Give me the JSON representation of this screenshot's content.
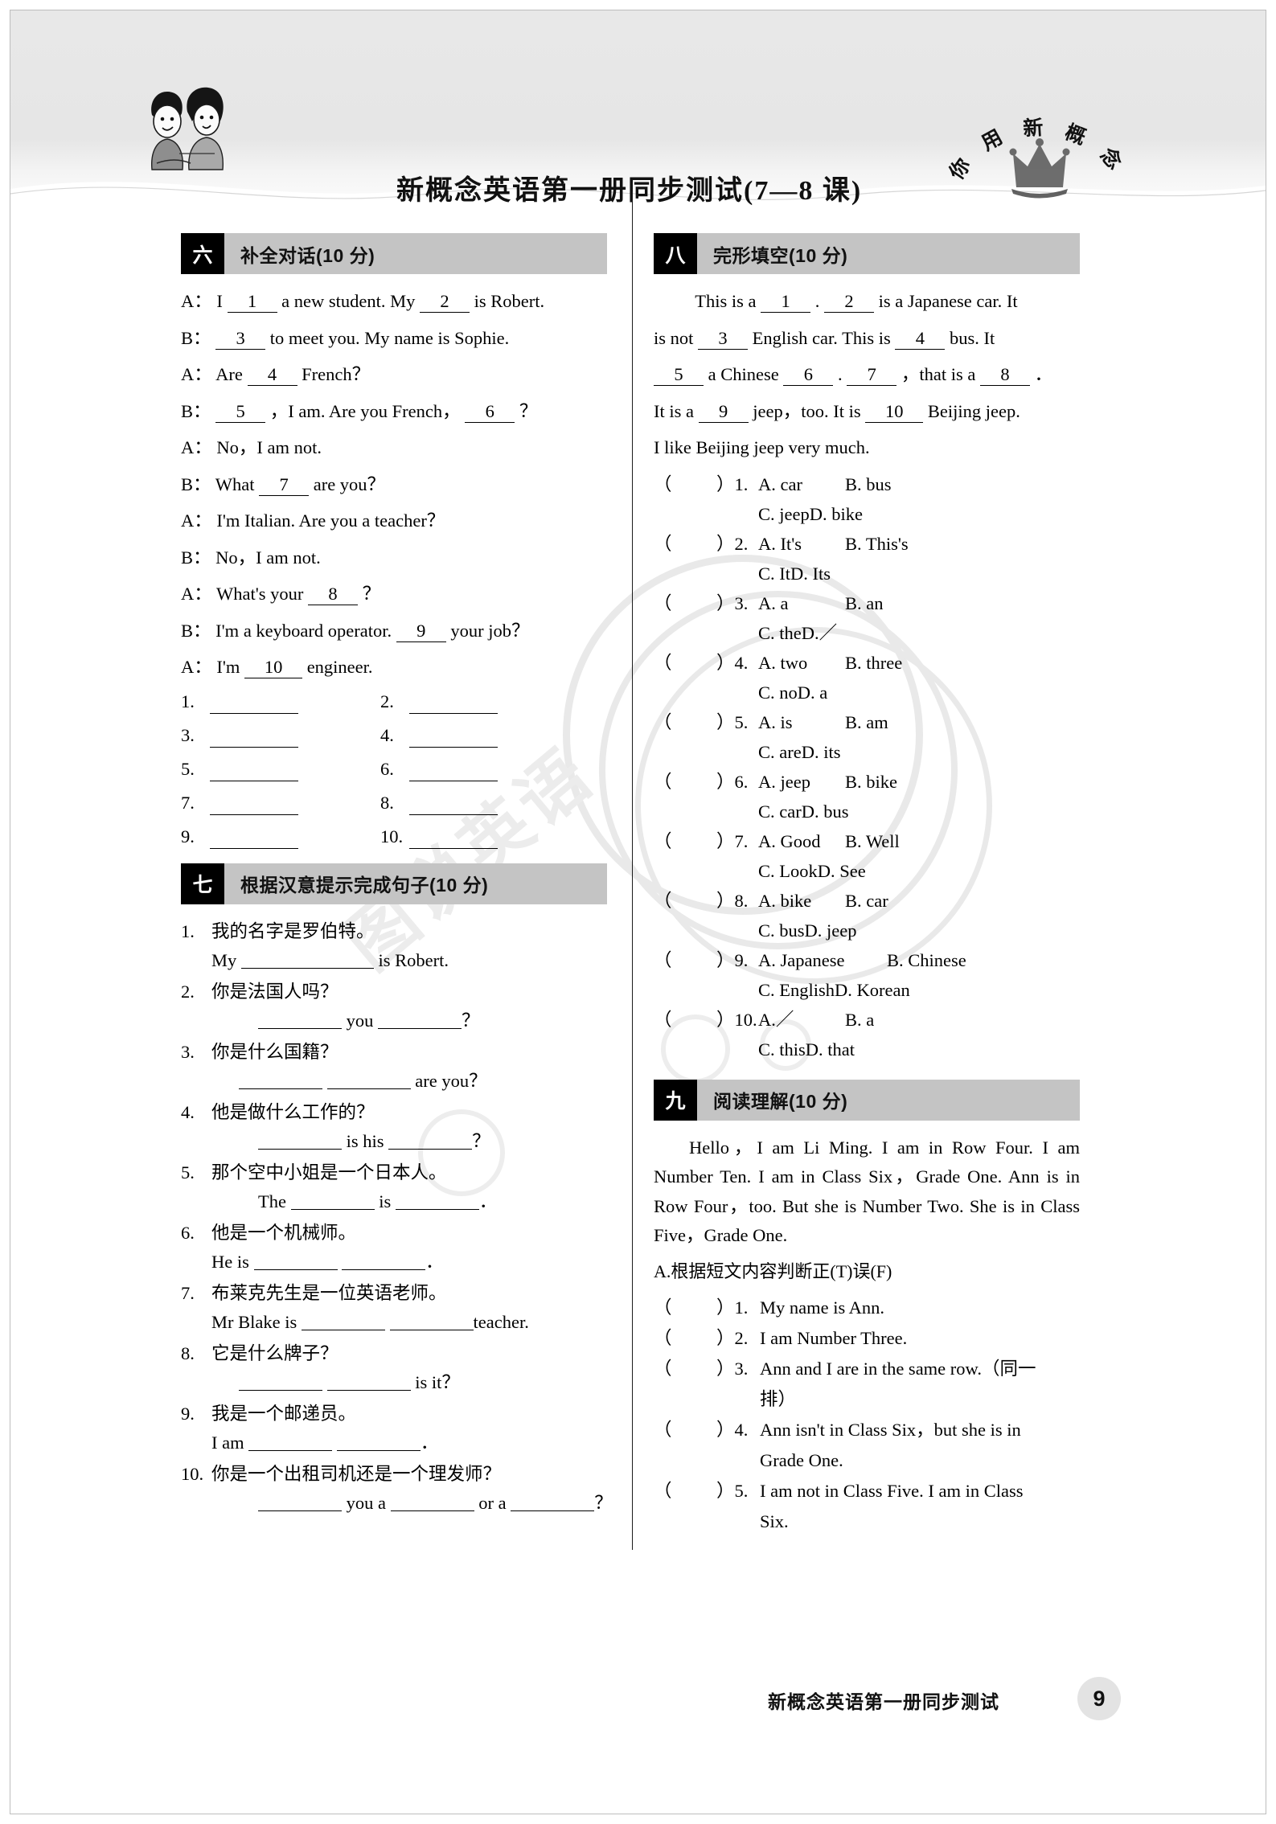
{
  "header": {
    "title": "新概念英语第一册同步测试(7—8 课)",
    "logo_chars": [
      "你",
      "用",
      "新",
      "概",
      "念"
    ],
    "mascot_alt": "two-students-illustration"
  },
  "watermark": {
    "text": "图说英语"
  },
  "sections": {
    "six": {
      "number": "六",
      "title": "补全对话(10 分)",
      "dialogue": [
        {
          "speaker": "A：",
          "parts": [
            {
              "t": "text",
              "v": "I"
            },
            {
              "t": "blank",
              "v": "1"
            },
            {
              "t": "text",
              "v": "a new student.  My"
            },
            {
              "t": "blank",
              "v": "2"
            },
            {
              "t": "text",
              "v": "is Robert."
            }
          ]
        },
        {
          "speaker": "B：",
          "parts": [
            {
              "t": "blank",
              "v": "3"
            },
            {
              "t": "text",
              "v": "to meet you.  My name is Sophie."
            }
          ]
        },
        {
          "speaker": "A：",
          "parts": [
            {
              "t": "text",
              "v": "Are"
            },
            {
              "t": "blank",
              "v": "4"
            },
            {
              "t": "text",
              "v": "French？"
            }
          ]
        },
        {
          "speaker": "B：",
          "parts": [
            {
              "t": "blank",
              "v": "5"
            },
            {
              "t": "text",
              "v": "，I am.  Are you French，"
            },
            {
              "t": "blank",
              "v": "6"
            },
            {
              "t": "text",
              "v": "？"
            }
          ]
        },
        {
          "speaker": "A：",
          "parts": [
            {
              "t": "text",
              "v": "No，I am not."
            }
          ]
        },
        {
          "speaker": "B：",
          "parts": [
            {
              "t": "text",
              "v": "What"
            },
            {
              "t": "blank",
              "v": "7"
            },
            {
              "t": "text",
              "v": "are you？"
            }
          ]
        },
        {
          "speaker": "A：",
          "parts": [
            {
              "t": "text",
              "v": "I'm Italian.  Are you a teacher？"
            }
          ]
        },
        {
          "speaker": "B：",
          "parts": [
            {
              "t": "text",
              "v": "No，I am not."
            }
          ]
        },
        {
          "speaker": "A：",
          "parts": [
            {
              "t": "text",
              "v": "What's your"
            },
            {
              "t": "blank",
              "v": "8"
            },
            {
              "t": "text",
              "v": "？"
            }
          ]
        },
        {
          "speaker": "B：",
          "parts": [
            {
              "t": "text",
              "v": "I'm a keyboard operator."
            },
            {
              "t": "blank",
              "v": "9"
            },
            {
              "t": "text",
              "v": "your job？"
            }
          ]
        },
        {
          "speaker": "A：",
          "parts": [
            {
              "t": "text",
              "v": "I'm"
            },
            {
              "t": "blank",
              "v": "10"
            },
            {
              "t": "text",
              "v": "engineer."
            }
          ]
        }
      ],
      "answer_numbers": [
        "1.",
        "2.",
        "3.",
        "4.",
        "5.",
        "6.",
        "7.",
        "8.",
        "9.",
        "10."
      ]
    },
    "seven": {
      "number": "七",
      "title": "根据汉意提示完成句子(10 分)",
      "items": [
        {
          "n": "1.",
          "cn": "我的名字是罗伯特。",
          "en_pre": "My",
          "blanks": 1,
          "en_post": "is Robert.",
          "style": "a"
        },
        {
          "n": "2.",
          "cn": "你是法国人吗？",
          "en_pre": "",
          "blanks": 2,
          "en_mid": "you",
          "en_post": "？",
          "style": "b"
        },
        {
          "n": "3.",
          "cn": "你是什么国籍？",
          "en_pre": "",
          "blanks": 2,
          "en_post": "are you？",
          "style": "c"
        },
        {
          "n": "4.",
          "cn": "他是做什么工作的？",
          "en_pre": "",
          "blanks": 2,
          "en_mid": "is his",
          "en_post": "？",
          "style": "b"
        },
        {
          "n": "5.",
          "cn": "那个空中小姐是一个日本人。",
          "en_pre": "The",
          "blanks": 2,
          "en_mid": "is",
          "en_post": "．",
          "style": "b"
        },
        {
          "n": "6.",
          "cn": "他是一个机械师。",
          "en_pre": "He is",
          "blanks": 2,
          "en_post": "．",
          "style": "d"
        },
        {
          "n": "7.",
          "cn": "布莱克先生是一位英语老师。",
          "en_pre": "Mr Blake is",
          "blanks": 2,
          "en_post": "teacher.",
          "style": "d"
        },
        {
          "n": "8.",
          "cn": "它是什么牌子？",
          "en_pre": "",
          "blanks": 2,
          "en_post": "is it？",
          "style": "c"
        },
        {
          "n": "9.",
          "cn": "我是一个邮递员。",
          "en_pre": "I am",
          "blanks": 2,
          "en_post": "．",
          "style": "d"
        },
        {
          "n": "10.",
          "cn": "你是一个出租司机还是一个理发师？",
          "en_pre": "",
          "blanks": 3,
          "en_mid": "you a",
          "en_mid2": "or a",
          "en_post": "？",
          "style": "e"
        }
      ]
    },
    "eight": {
      "number": "八",
      "title": "完形填空(10 分)",
      "passage_lines": [
        [
          {
            "t": "indent"
          },
          {
            "t": "text",
            "v": "This is a"
          },
          {
            "t": "blank",
            "v": "1"
          },
          {
            "t": "text",
            "v": ".  "
          },
          {
            "t": "blank",
            "v": "2"
          },
          {
            "t": "text",
            "v": "is a Japanese car.  It"
          }
        ],
        [
          {
            "t": "text",
            "v": "is not"
          },
          {
            "t": "blank",
            "v": "3"
          },
          {
            "t": "text",
            "v": "English car.  This is"
          },
          {
            "t": "blank",
            "v": "4"
          },
          {
            "t": "text",
            "v": "bus.  It"
          }
        ],
        [
          {
            "t": "blank",
            "v": "5"
          },
          {
            "t": "text",
            "v": "a Chinese"
          },
          {
            "t": "blank",
            "v": "6"
          },
          {
            "t": "text",
            "v": ".  "
          },
          {
            "t": "blank",
            "v": "7"
          },
          {
            "t": "text",
            "v": "，that is a"
          },
          {
            "t": "blank",
            "v": "8"
          },
          {
            "t": "text",
            "v": "．"
          }
        ],
        [
          {
            "t": "text",
            "v": "It is a"
          },
          {
            "t": "blank",
            "v": "9"
          },
          {
            "t": "text",
            "v": "jeep，too.  It is"
          },
          {
            "t": "blank",
            "v": "10"
          },
          {
            "t": "text",
            "v": "Beijing jeep."
          }
        ],
        [
          {
            "t": "text",
            "v": "I like Beijing jeep very much."
          }
        ]
      ],
      "questions": [
        {
          "n": "1.",
          "a": "A. car",
          "b": "B. bus",
          "c": "C. jeep",
          "d": "D. bike",
          "wide": false
        },
        {
          "n": "2.",
          "a": "A.  It's",
          "b": "B. This's",
          "c": "C. It",
          "d": "D. Its",
          "wide": false
        },
        {
          "n": "3.",
          "a": "A. a",
          "b": "B. an",
          "c": "C. the",
          "d": "D.／",
          "wide": false
        },
        {
          "n": "4.",
          "a": "A. two",
          "b": "B. three",
          "c": "C. no",
          "d": "D. a",
          "wide": false
        },
        {
          "n": "5.",
          "a": "A. is",
          "b": "B. am",
          "c": "C. are",
          "d": "D. its",
          "wide": false
        },
        {
          "n": "6.",
          "a": "A. jeep",
          "b": "B. bike",
          "c": "C. car",
          "d": "D. bus",
          "wide": false
        },
        {
          "n": "7.",
          "a": "A. Good",
          "b": "B. Well",
          "c": "C. Look",
          "d": "D. See",
          "wide": false
        },
        {
          "n": "8.",
          "a": "A. bike",
          "b": "B. car",
          "c": "C. bus",
          "d": "D. jeep",
          "wide": false
        },
        {
          "n": "9.",
          "a": "A. Japanese",
          "b": "B. Chinese",
          "c": "C. English",
          "d": "D. Korean",
          "wide": true
        },
        {
          "n": "10.",
          "a": "A.／",
          "b": "B. a",
          "c": "C. this",
          "d": "D. that",
          "wide": false
        }
      ]
    },
    "nine": {
      "number": "九",
      "title": "阅读理解(10 分)",
      "passage": "Hello，I am Li Ming.  I am in Row Four.  I am Number Ten.  I am in Class Six，Grade One.  Ann is in Row Four，too.  But she is Number Two.  She is in Class Five，Grade One.",
      "part_a_label": "A.根据短文内容判断正(T)误(F)",
      "tf_items": [
        {
          "n": "1.",
          "text": "My name is Ann.",
          "cont": ""
        },
        {
          "n": "2.",
          "text": "I am Number Three.",
          "cont": ""
        },
        {
          "n": "3.",
          "text": "Ann and I are in the same row.（同一",
          "cont": "排）"
        },
        {
          "n": "4.",
          "text": "Ann isn't in Class Six，but she is in",
          "cont": "Grade One."
        },
        {
          "n": "5.",
          "text": "I am not in Class Five.  I am in Class",
          "cont": "Six."
        }
      ]
    }
  },
  "footer": {
    "text": "新概念英语第一册同步测试",
    "page": "9"
  }
}
